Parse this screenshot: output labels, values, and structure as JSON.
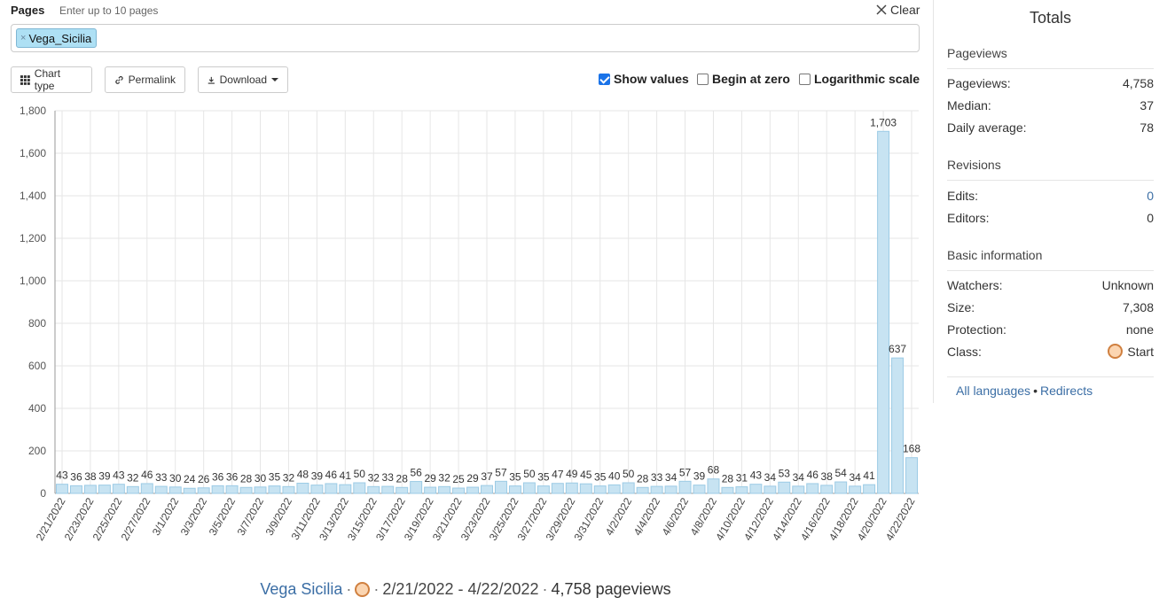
{
  "pages": {
    "label": "Pages",
    "hint": "Enter up to 10 pages",
    "clear_label": "Clear",
    "selected": [
      "Vega_Sicilia"
    ]
  },
  "toolbar": {
    "chart_type_label": "Chart type",
    "permalink_label": "Permalink",
    "download_label": "Download"
  },
  "options": {
    "show_values": {
      "label": "Show values",
      "checked": true
    },
    "begin_at_zero": {
      "label": "Begin at zero",
      "checked": false
    },
    "log_scale": {
      "label": "Logarithmic scale",
      "checked": false
    }
  },
  "chart_data": {
    "type": "bar",
    "categories": [
      "2/21/2022",
      "2/22/2022",
      "2/23/2022",
      "2/24/2022",
      "2/25/2022",
      "2/26/2022",
      "2/27/2022",
      "2/28/2022",
      "3/1/2022",
      "3/2/2022",
      "3/3/2022",
      "3/4/2022",
      "3/5/2022",
      "3/6/2022",
      "3/7/2022",
      "3/8/2022",
      "3/9/2022",
      "3/10/2022",
      "3/11/2022",
      "3/12/2022",
      "3/13/2022",
      "3/14/2022",
      "3/15/2022",
      "3/16/2022",
      "3/17/2022",
      "3/18/2022",
      "3/19/2022",
      "3/20/2022",
      "3/21/2022",
      "3/22/2022",
      "3/23/2022",
      "3/24/2022",
      "3/25/2022",
      "3/26/2022",
      "3/27/2022",
      "3/28/2022",
      "3/29/2022",
      "3/30/2022",
      "3/31/2022",
      "4/1/2022",
      "4/2/2022",
      "4/3/2022",
      "4/4/2022",
      "4/5/2022",
      "4/6/2022",
      "4/7/2022",
      "4/8/2022",
      "4/9/2022",
      "4/10/2022",
      "4/11/2022",
      "4/12/2022",
      "4/13/2022",
      "4/14/2022",
      "4/15/2022",
      "4/16/2022",
      "4/17/2022",
      "4/18/2022",
      "4/19/2022",
      "4/20/2022",
      "4/21/2022",
      "4/22/2022"
    ],
    "tick_labels": [
      "2/21/2022",
      "2/23/2022",
      "2/25/2022",
      "2/27/2022",
      "3/1/2022",
      "3/3/2022",
      "3/5/2022",
      "3/7/2022",
      "3/9/2022",
      "3/11/2022",
      "3/13/2022",
      "3/15/2022",
      "3/17/2022",
      "3/19/2022",
      "3/21/2022",
      "3/23/2022",
      "3/25/2022",
      "3/27/2022",
      "3/29/2022",
      "3/31/2022",
      "4/2/2022",
      "4/4/2022",
      "4/6/2022",
      "4/8/2022",
      "4/10/2022",
      "4/12/2022",
      "4/14/2022",
      "4/16/2022",
      "4/18/2022",
      "4/20/2022",
      "4/22/2022"
    ],
    "values": [
      43,
      36,
      38,
      39,
      43,
      32,
      46,
      33,
      30,
      24,
      26,
      36,
      36,
      28,
      30,
      35,
      32,
      48,
      39,
      46,
      41,
      50,
      32,
      33,
      28,
      56,
      29,
      32,
      25,
      29,
      37,
      57,
      35,
      50,
      35,
      47,
      49,
      45,
      35,
      40,
      50,
      28,
      33,
      34,
      57,
      39,
      68,
      28,
      31,
      43,
      34,
      53,
      34,
      46,
      38,
      54,
      34,
      41,
      1703,
      637,
      168
    ],
    "value_labels": [
      "43",
      "36",
      "38",
      "39",
      "43",
      "32",
      "46",
      "33",
      "30",
      "24",
      "26",
      "36",
      "36",
      "28",
      "30",
      "35",
      "32",
      "48",
      "39",
      "46",
      "41",
      "50",
      "32",
      "33",
      "28",
      "56",
      "29",
      "32",
      "25",
      "29",
      "37",
      "57",
      "35",
      "50",
      "35",
      "47",
      "49",
      "45",
      "35",
      "40",
      "50",
      "28",
      "33",
      "34",
      "57",
      "39",
      "68",
      "28",
      "31",
      "43",
      "34",
      "53",
      "34",
      "46",
      "38",
      "54",
      "34",
      "41",
      "1,703",
      "637",
      "168"
    ],
    "yticks": [
      0,
      200,
      400,
      600,
      800,
      1000,
      1200,
      1400,
      1600,
      1800
    ],
    "ytick_labels": [
      "0",
      "200",
      "400",
      "600",
      "800",
      "1,000",
      "1,200",
      "1,400",
      "1,600",
      "1,800"
    ],
    "ylim": [
      0,
      1800
    ],
    "grid": true,
    "colors": {
      "bar_fill": "#c7e3f2",
      "bar_stroke": "#9ccbe5",
      "grid": "#e6e6e6"
    }
  },
  "summary": {
    "title": "Vega Sicilia",
    "range": "2/21/2022 - 4/22/2022",
    "total": "4,758 pageviews"
  },
  "sidebar": {
    "title": "Totals",
    "pageviews_heading": "Pageviews",
    "pageviews": [
      {
        "label": "Pageviews:",
        "value": "4,758"
      },
      {
        "label": "Median:",
        "value": "37"
      },
      {
        "label": "Daily average:",
        "value": "78"
      }
    ],
    "revisions_heading": "Revisions",
    "revisions": [
      {
        "label": "Edits:",
        "value": "0"
      },
      {
        "label": "Editors:",
        "value": "0"
      }
    ],
    "basic_heading": "Basic information",
    "basic": [
      {
        "label": "Watchers:",
        "value": "Unknown"
      },
      {
        "label": "Size:",
        "value": "7,308"
      },
      {
        "label": "Protection:",
        "value": "none"
      },
      {
        "label": "Class:",
        "value": "Start"
      }
    ],
    "all_languages": "All languages",
    "redirects": "Redirects"
  }
}
